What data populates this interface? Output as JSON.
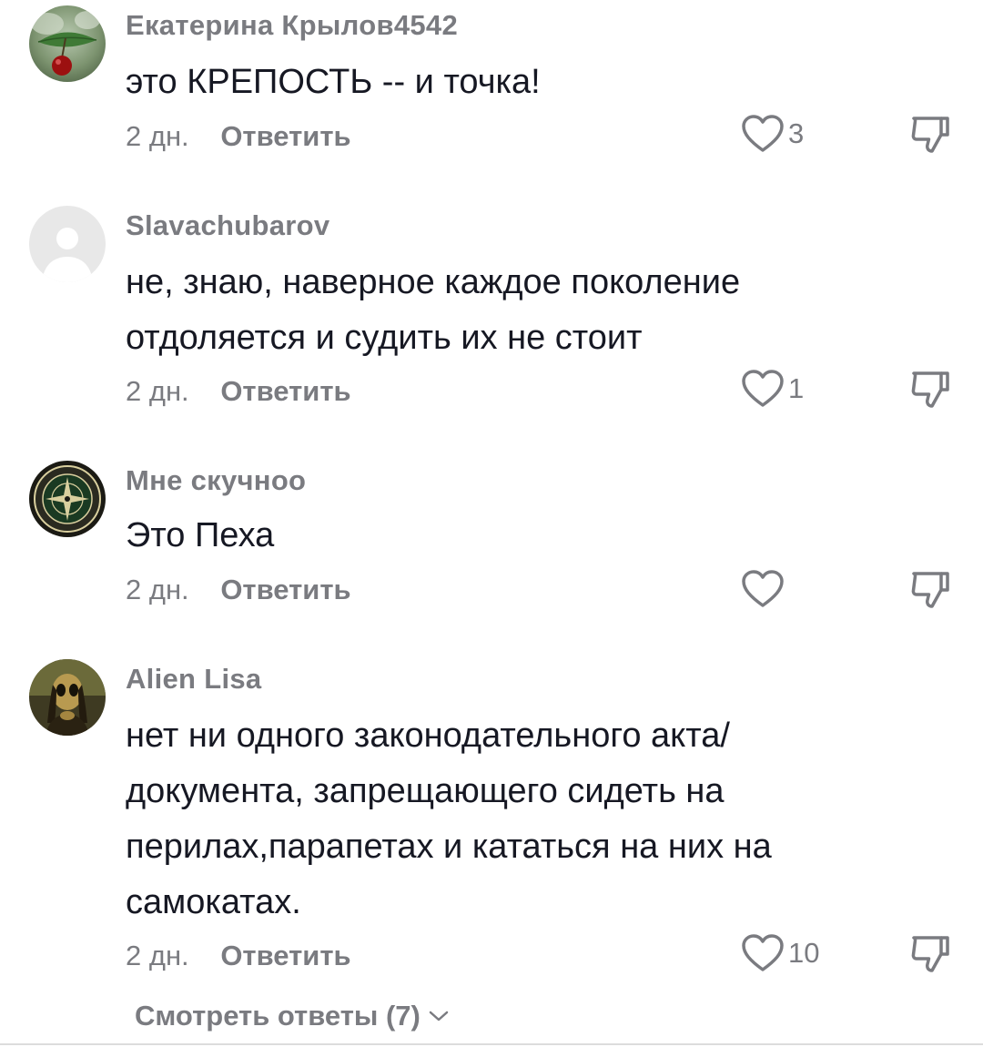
{
  "comments": [
    {
      "username": "Екатерина Крылов4542",
      "text": "это КРЕПОСТЬ -- и точка!",
      "time": "2 дн.",
      "reply_label": "Ответить",
      "likes": "3",
      "avatar": "cherry-avatar"
    },
    {
      "username": "Slavachubarov",
      "text": "не, знаю, наверное каждое поколение отдоляется и судить их не стоит",
      "time": "2 дн.",
      "reply_label": "Ответить",
      "likes": "1",
      "avatar": "default-avatar"
    },
    {
      "username": "Мне скучноо",
      "text": "Это Пеха",
      "time": "2 дн.",
      "reply_label": "Ответить",
      "likes": "",
      "avatar": "stone-island-badge-avatar"
    },
    {
      "username": "Alien Lisa",
      "text": "нет ни одного законодательного акта/ документа, запрещающего сидеть на перилах,парапетах и кататься на них на самокатах.",
      "time": "2 дн.",
      "reply_label": "Ответить",
      "likes": "10",
      "avatar": "alien-mona-lisa-avatar"
    }
  ],
  "view_replies_label": "Смотреть ответы (7)",
  "icons": {
    "like": "heart-outline-icon",
    "dislike": "thumbs-down-icon",
    "expand": "chevron-down-icon"
  },
  "colors": {
    "text": "#161823",
    "secondary": "#7a7b80",
    "background": "#ffffff"
  }
}
